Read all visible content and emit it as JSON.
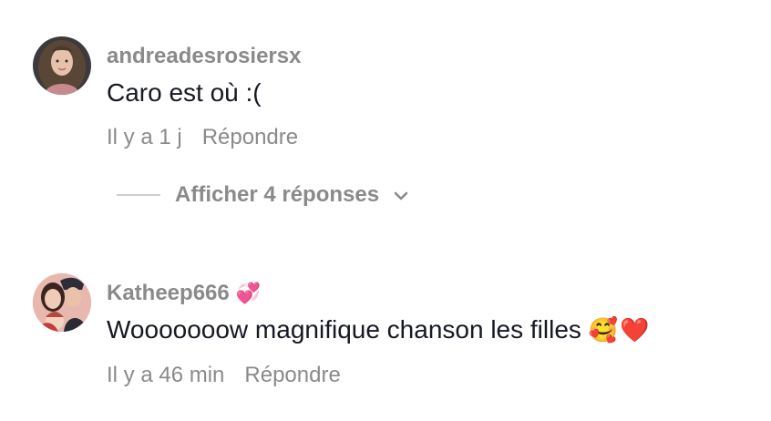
{
  "comments": [
    {
      "username": "andreadesrosiersx",
      "text": "Caro est où :(",
      "time": "Il y a 1 j",
      "reply_label": "Répondre"
    },
    {
      "username": "Katheep666",
      "badge": "💞",
      "text": "Wooooooow magnifique chanson les filles",
      "emoji_1": "🥰",
      "emoji_2": "❤️",
      "time": "Il y a 46 min",
      "reply_label": "Répondre"
    }
  ],
  "view_replies": {
    "label": "Afficher 4 réponses"
  },
  "colors": {
    "meta_gray": "#8a8a8a",
    "text_dark": "#161823",
    "divider": "#cfcfcf"
  },
  "icons": {
    "expand": "chevron-down-icon"
  }
}
